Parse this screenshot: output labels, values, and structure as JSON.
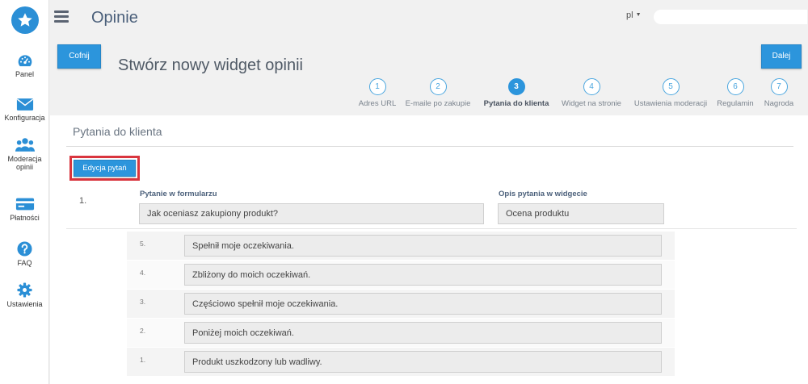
{
  "app": {
    "title": "Opinie",
    "language": "pl",
    "search_value": ""
  },
  "sidebar": {
    "items": [
      {
        "label": "Panel",
        "icon": "dashboard-icon"
      },
      {
        "label": "Konfiguracja",
        "icon": "envelope-icon"
      },
      {
        "label": "Moderacja opinii",
        "icon": "users-icon"
      },
      {
        "label": "Płatności",
        "icon": "credit-card-icon"
      },
      {
        "label": "FAQ",
        "icon": "question-icon"
      },
      {
        "label": "Ustawienia",
        "icon": "gear-icon"
      }
    ]
  },
  "toolbar": {
    "back_label": "Cofnij",
    "next_label": "Dalej"
  },
  "page": {
    "title": "Stwórz nowy widget opinii"
  },
  "wizard": {
    "active_step": 3,
    "steps": [
      {
        "num": "1",
        "label": "Adres URL"
      },
      {
        "num": "2",
        "label": "E-maile po zakupie"
      },
      {
        "num": "3",
        "label": "Pytania do klienta"
      },
      {
        "num": "4",
        "label": "Widget na stronie"
      },
      {
        "num": "5",
        "label": "Ustawienia moderacji"
      },
      {
        "num": "6",
        "label": "Regulamin"
      },
      {
        "num": "7",
        "label": "Nagroda"
      }
    ]
  },
  "section": {
    "title": "Pytania do klienta",
    "edit_button": "Edycja pytań",
    "question": {
      "number": "1.",
      "form_label": "Pytanie w formularzu",
      "form_value": "Jak oceniasz zakupiony produkt?",
      "widget_label": "Opis pytania w widgecie",
      "widget_value": "Ocena produktu"
    },
    "answers": [
      {
        "score": "5.",
        "text": "Spełnił moje oczekiwania."
      },
      {
        "score": "4.",
        "text": "Zbliżony do moich oczekiwań."
      },
      {
        "score": "3.",
        "text": "Częściowo spełnił moje oczekiwania."
      },
      {
        "score": "2.",
        "text": "Poniżej moich oczekiwań."
      },
      {
        "score": "1.",
        "text": "Produkt uszkodzony lub wadliwy."
      }
    ]
  },
  "colors": {
    "accent": "#2c95dc",
    "highlight": "#d9353e"
  }
}
